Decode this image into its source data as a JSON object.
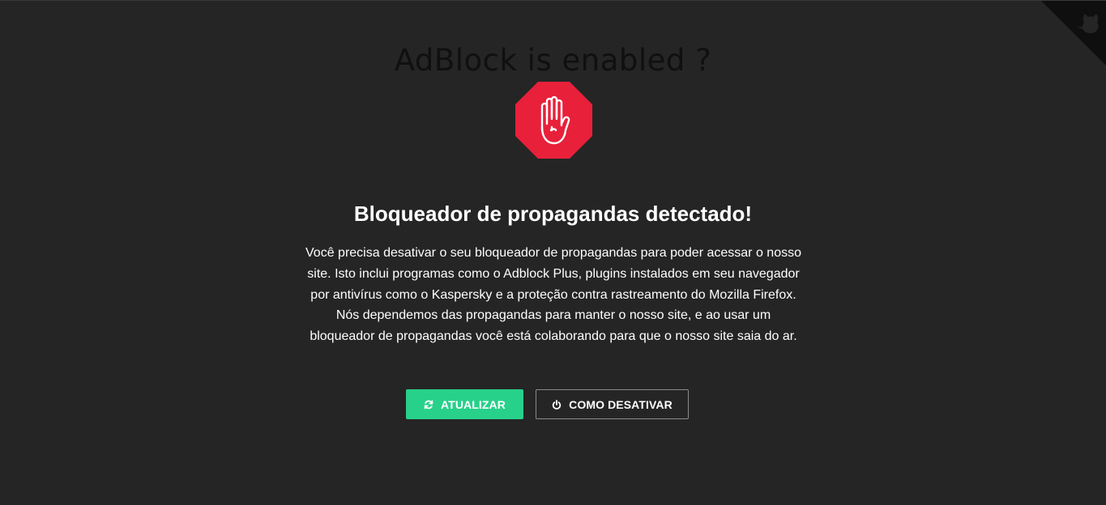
{
  "header": {
    "heading": "AdBlock is enabled ?"
  },
  "icons": {
    "stop_icon": "stop-hand-icon",
    "corner_icon": "github-cat-icon",
    "refresh_icon": "refresh-icon",
    "power_icon": "power-icon"
  },
  "colors": {
    "background": "#252525",
    "stop_red": "#e8203a",
    "update_green": "#27d18a"
  },
  "main": {
    "title": "Bloqueador de propagandas detectado!",
    "message_lines": [
      "Você precisa desativar o seu bloqueador de propagandas para poder acessar o nosso",
      "site. Isto inclui programas como o Adblock Plus, plugins instalados em seu navegador",
      "por antivírus como o Kaspersky e a proteção contra rastreamento do Mozilla Firefox.",
      "Nós dependemos das propagandas para manter o nosso site, e ao usar um",
      "bloqueador de propagandas você está colaborando para que o nosso site saia do ar."
    ]
  },
  "actions": {
    "update_label": "ATUALIZAR",
    "howto_label": "COMO DESATIVAR"
  }
}
